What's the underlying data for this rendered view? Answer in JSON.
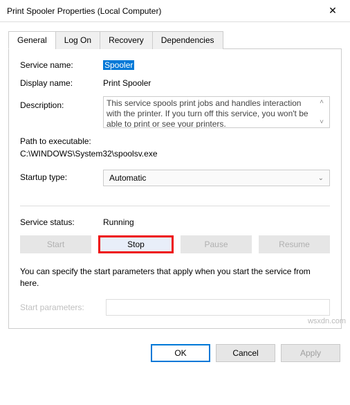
{
  "window": {
    "title": "Print Spooler Properties (Local Computer)"
  },
  "tabs": {
    "items": [
      "General",
      "Log On",
      "Recovery",
      "Dependencies"
    ],
    "active": 0
  },
  "fields": {
    "service_name_label": "Service name:",
    "service_name_value": "Spooler",
    "display_name_label": "Display name:",
    "display_name_value": "Print Spooler",
    "description_label": "Description:",
    "description_value": "This service spools print jobs and handles interaction with the printer.  If you turn off this service, you won't be able to print or see your printers.",
    "path_label": "Path to executable:",
    "path_value": "C:\\WINDOWS\\System32\\spoolsv.exe",
    "startup_label": "Startup type:",
    "startup_value": "Automatic",
    "status_label": "Service status:",
    "status_value": "Running",
    "hint": "You can specify the start parameters that apply when you start the service from here.",
    "params_label": "Start parameters:",
    "params_value": ""
  },
  "service_buttons": {
    "start": "Start",
    "stop": "Stop",
    "pause": "Pause",
    "resume": "Resume"
  },
  "dialog_buttons": {
    "ok": "OK",
    "cancel": "Cancel",
    "apply": "Apply"
  },
  "watermark": "wsxdn.com"
}
